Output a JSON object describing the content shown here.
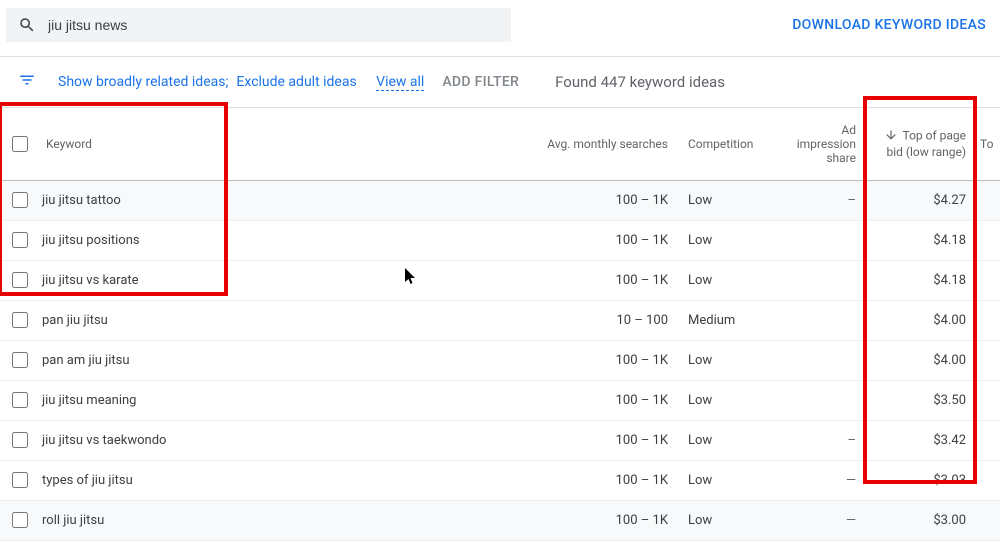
{
  "search": {
    "value": "jiu jitsu news"
  },
  "download_label": "DOWNLOAD KEYWORD IDEAS",
  "filters": {
    "broad": "Show broadly related ideas;",
    "exclude": "Exclude adult ideas",
    "view_all": "View all",
    "add": "ADD FILTER",
    "found": "Found 447 keyword ideas"
  },
  "headers": {
    "keyword": "Keyword",
    "avg": "Avg. monthly searches",
    "competition": "Competition",
    "impression": "Ad impression share",
    "bid_low": "Top of page bid (low range)",
    "extra": "To"
  },
  "rows": [
    {
      "kw": "jiu jitsu tattoo",
      "avg": "100 – 1K",
      "comp": "Low",
      "imp": "–",
      "bid": "$4.27",
      "shade": true
    },
    {
      "kw": "jiu jitsu positions",
      "avg": "100 – 1K",
      "comp": "Low",
      "imp": "",
      "bid": "$4.18",
      "shade": false
    },
    {
      "kw": "jiu jitsu vs karate",
      "avg": "100 – 1K",
      "comp": "Low",
      "imp": "",
      "bid": "$4.18",
      "shade": false
    },
    {
      "kw": "pan jiu jitsu",
      "avg": "10 – 100",
      "comp": "Medium",
      "imp": "",
      "bid": "$4.00",
      "shade": false
    },
    {
      "kw": "pan am jiu jitsu",
      "avg": "100 – 1K",
      "comp": "Low",
      "imp": "",
      "bid": "$4.00",
      "shade": false
    },
    {
      "kw": "jiu jitsu meaning",
      "avg": "100 – 1K",
      "comp": "Low",
      "imp": "",
      "bid": "$3.50",
      "shade": false
    },
    {
      "kw": "jiu jitsu vs taekwondo",
      "avg": "100 – 1K",
      "comp": "Low",
      "imp": "–",
      "bid": "$3.42",
      "shade": false
    },
    {
      "kw": "types of jiu jitsu",
      "avg": "100 – 1K",
      "comp": "Low",
      "imp": "—",
      "bid": "$3.03",
      "shade": false
    },
    {
      "kw": "roll jiu jitsu",
      "avg": "100 – 1K",
      "comp": "Low",
      "imp": "—",
      "bid": "$3.00",
      "shade": true
    }
  ]
}
